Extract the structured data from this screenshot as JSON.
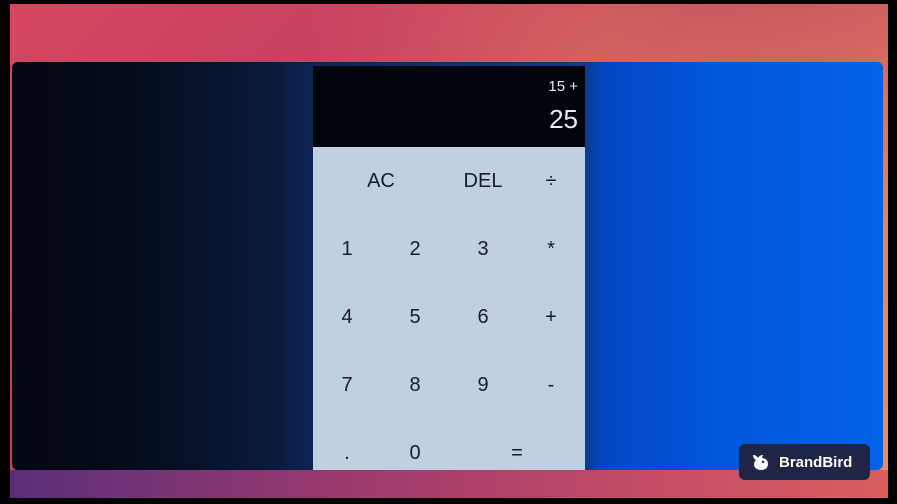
{
  "display": {
    "previous": "15 +",
    "current": "25"
  },
  "keys": {
    "ac": "AC",
    "del": "DEL",
    "divide": "÷",
    "one": "1",
    "two": "2",
    "three": "3",
    "multiply": "*",
    "four": "4",
    "five": "5",
    "six": "6",
    "plus": "+",
    "seven": "7",
    "eight": "8",
    "nine": "9",
    "minus": "-",
    "dot": ".",
    "zero": "0",
    "equals": "="
  },
  "watermark": {
    "label": "BrandBird",
    "icon": "bird-icon"
  },
  "colors": {
    "calculator_bg": "#c1cfe2",
    "display_bg": "#02060c",
    "watermark_bg": "#1f2547"
  }
}
